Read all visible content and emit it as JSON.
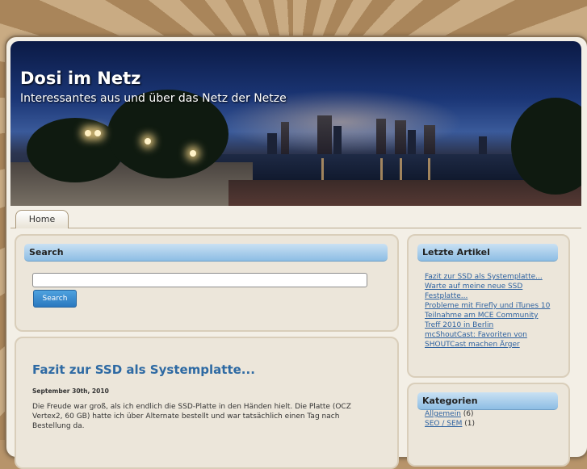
{
  "site": {
    "title": "Dosi im Netz",
    "description": "Interessantes aus und über das Netz der Netze"
  },
  "nav": {
    "tabs": [
      {
        "label": "Home"
      }
    ]
  },
  "search_widget": {
    "heading": "Search",
    "input_value": "",
    "button_label": "Search"
  },
  "post": {
    "title": "Fazit zur SSD als Systemplatte...",
    "date": "September 30th, 2010",
    "body": "Die Freude war groß, als ich endlich die SSD-Platte in den Händen hielt. Die Platte (OCZ Vertex2, 60 GB) hatte ich über Alternate bestellt und war tatsächlich einen Tag nach Bestellung da."
  },
  "recent_widget": {
    "heading": "Letzte Artikel",
    "items": [
      "Fazit zur SSD als Systemplatte...",
      "Warte auf meine neue SSD Festplatte...",
      "Probleme mit Firefly und iTunes 10",
      "Teilnahme am MCE Community Treff 2010 in Berlin",
      "mcShoutCast: Favoriten von SHOUTCast machen Ärger"
    ]
  },
  "categories_widget": {
    "heading": "Kategorien",
    "items": [
      {
        "label": "Allgemein",
        "count": "(6)"
      },
      {
        "label": "SEO / SEM",
        "count": "(1)"
      }
    ]
  },
  "colors": {
    "link": "#2e62a0",
    "widget_bar": "#8dbde4",
    "search_button": "#2a78bf"
  }
}
